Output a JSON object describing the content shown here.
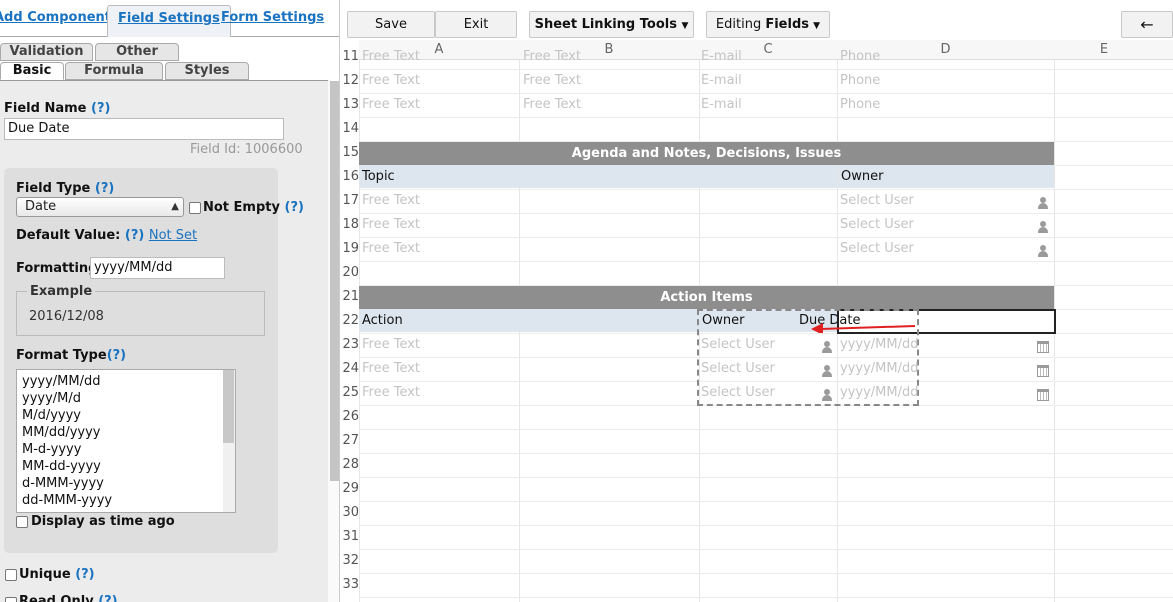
{
  "top_tabs": {
    "add_components": "Add Components",
    "field_settings": "Field Settings",
    "form_settings": "Form Settings"
  },
  "sub_tabs": {
    "validation": "Validation",
    "other": "Other",
    "basic": "Basic",
    "formula": "Formula",
    "styles": "Styles"
  },
  "field": {
    "name_label": "Field Name",
    "help": "(?)",
    "name_value": "Due Date",
    "field_id": "Field Id: 1006600",
    "type_label": "Field Type",
    "type_value": "Date",
    "not_empty_label": "Not Empty",
    "default_label": "Default Value:",
    "default_value": "Not Set",
    "formatting_label": "Formatting:",
    "formatting_value": "yyyy/MM/dd",
    "example_label": "Example",
    "example_value": "2016/12/08",
    "format_type_label": "Format Type",
    "format_types": [
      "yyyy/MM/dd",
      "yyyy/M/d",
      "M/d/yyyy",
      "MM/dd/yyyy",
      "M-d-yyyy",
      "MM-dd-yyyy",
      "d-MMM-yyyy",
      "dd-MMM-yyyy"
    ],
    "display_time_label": "Display as time ago",
    "unique_label": "Unique",
    "read_only_label": "Read Only"
  },
  "toolbar": {
    "save": "Save",
    "exit": "Exit",
    "sheet_linking": "Sheet Linking Tools",
    "editing_prefix": "Editing ",
    "editing_bold": "Fields",
    "back_icon": "←"
  },
  "sheet": {
    "columns": [
      "A",
      "B",
      "C",
      "D",
      "E"
    ],
    "rows": [
      "11",
      "12",
      "13",
      "14",
      "15",
      "16",
      "17",
      "18",
      "19",
      "20",
      "21",
      "22",
      "23",
      "24",
      "25",
      "26",
      "27",
      "28",
      "29",
      "30",
      "31",
      "32",
      "33"
    ],
    "free_text": "Free Text",
    "email": "E-mail",
    "phone": "Phone",
    "agenda_title": "Agenda and Notes, Decisions, Issues",
    "topic": "Topic",
    "owner": "Owner",
    "select_user": "Select User",
    "action_items_title": "Action Items",
    "action": "Action",
    "due_date": "Due Date",
    "date_placeholder": "yyyy/MM/dd"
  },
  "colors": {
    "accent": "#1a73c0",
    "band": "#8e8e8e",
    "header_row": "#dde5ee",
    "placeholder": "#c4c4c4",
    "arrow": "#e02020"
  }
}
